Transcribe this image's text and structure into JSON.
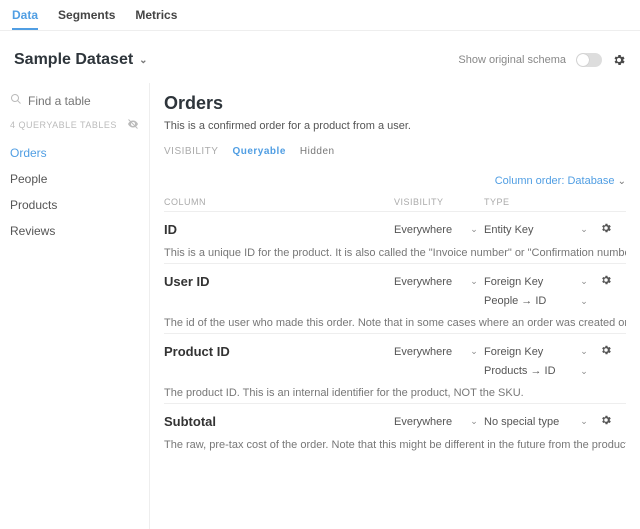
{
  "tabs": {
    "data": "Data",
    "segments": "Segments",
    "metrics": "Metrics"
  },
  "header": {
    "dataset_title": "Sample Dataset",
    "show_schema": "Show original schema"
  },
  "sidebar": {
    "search_placeholder": "Find a table",
    "queryable_label": "4 QUERYABLE TABLES",
    "items": [
      "Orders",
      "People",
      "Products",
      "Reviews"
    ]
  },
  "main": {
    "title": "Orders",
    "description": "This is a confirmed order for a product from a user.",
    "subtabs": {
      "label": "VISIBILITY",
      "queryable": "Queryable",
      "hidden": "Hidden"
    },
    "column_order": "Column order: Database",
    "headers": {
      "column": "COLUMN",
      "visibility": "VISIBILITY",
      "type": "TYPE"
    },
    "fields": [
      {
        "name": "ID",
        "visibility": "Everywhere",
        "type": "Entity Key",
        "fk": null,
        "desc": "This is a unique ID for the product. It is also called the \"Invoice number\" or \"Confirmation number\" in customer facing emails an"
      },
      {
        "name": "User ID",
        "visibility": "Everywhere",
        "type": "Foreign Key",
        "fk": "People → ID",
        "desc": "The id of the user who made this order. Note that in some cases where an order was created on behalf of a customer who phor"
      },
      {
        "name": "Product ID",
        "visibility": "Everywhere",
        "type": "Foreign Key",
        "fk": "Products → ID",
        "desc": "The product ID. This is an internal identifier for the product, NOT the SKU."
      },
      {
        "name": "Subtotal",
        "visibility": "Everywhere",
        "type": "No special type",
        "fk": null,
        "desc": "The raw, pre-tax cost of the order. Note that this might be different in the future from the product price due to promotions, cre"
      }
    ]
  }
}
